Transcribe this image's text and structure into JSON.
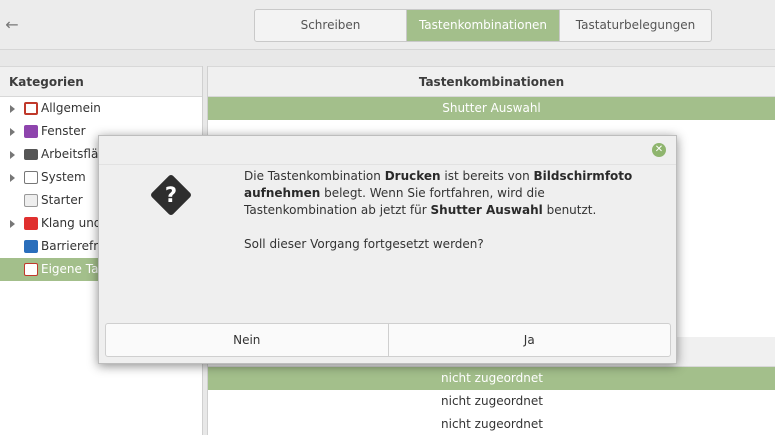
{
  "header": {
    "back_icon": "arrow-left-icon",
    "tabs": [
      {
        "label": "Schreiben",
        "active": false
      },
      {
        "label": "Tastenkombinationen",
        "active": true
      },
      {
        "label": "Tastaturbelegungen",
        "active": false
      }
    ]
  },
  "categories": {
    "header": "Kategorien",
    "items": [
      {
        "label": "Allgemein",
        "icon": "general-icon",
        "icon_color": "#c0392b",
        "expandable": true
      },
      {
        "label": "Fenster",
        "icon": "windows-icon",
        "icon_color": "#8e44ad",
        "expandable": true
      },
      {
        "label": "Arbeitsfläc",
        "icon": "workspace-icon",
        "icon_color": "#555555",
        "expandable": true
      },
      {
        "label": "System",
        "icon": "system-icon",
        "icon_color": "#777777",
        "expandable": true
      },
      {
        "label": "Starter",
        "icon": "launcher-icon",
        "icon_color": "#999999",
        "expandable": false
      },
      {
        "label": "Klang und",
        "icon": "sound-icon",
        "icon_color": "#e0302f",
        "expandable": true
      },
      {
        "label": "Barrierefre",
        "icon": "accessibility-icon",
        "icon_color": "#2a6ebb",
        "expandable": false
      },
      {
        "label": "Eigene Tas",
        "icon": "custom-icon",
        "icon_color": "#c0392b",
        "expandable": false,
        "selected": true
      }
    ]
  },
  "shortcuts": {
    "header": "Tastenkombinationen",
    "selected_row": "Shutter Auswahl",
    "lower_rows": [
      "nicht zugeordnet",
      "nicht zugeordnet",
      "nicht zugeordnet"
    ]
  },
  "dialog": {
    "close_icon": "close-icon",
    "question_icon": "question-icon",
    "msg_part1": "Die Tastenkombination ",
    "msg_key": "Drucken",
    "msg_part2": " ist bereits von ",
    "msg_owner": "Bildschirmfoto aufnehmen",
    "msg_part3": " belegt.  Wenn Sie fortfahren, wird die Tastenkombination ab jetzt für ",
    "msg_target": "Shutter Auswahl",
    "msg_part4": " benutzt.",
    "question": "Soll dieser Vorgang fortgesetzt werden?",
    "buttons": {
      "no": "Nein",
      "yes": "Ja"
    }
  }
}
